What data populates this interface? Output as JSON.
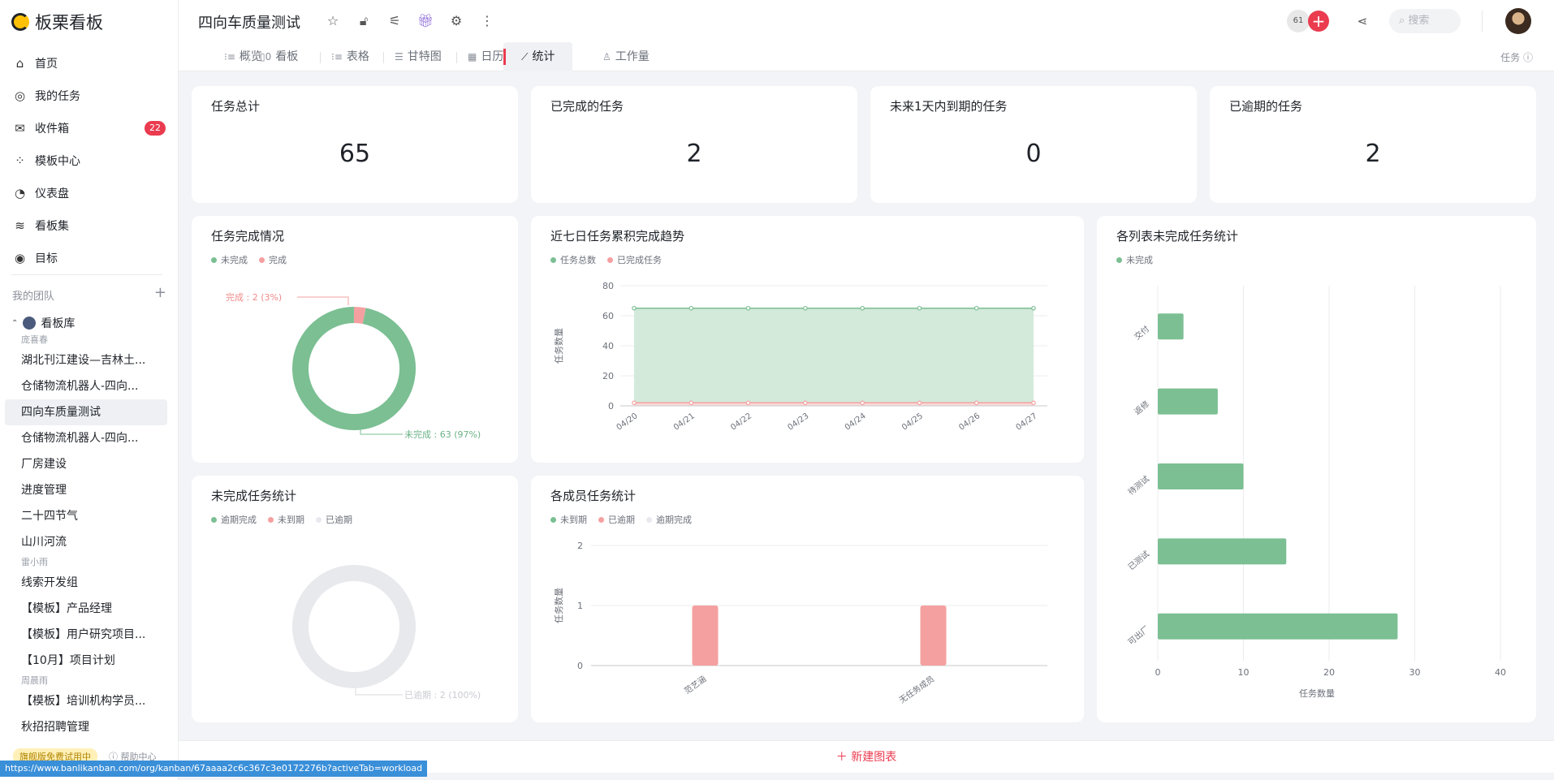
{
  "app": {
    "name": "板栗看板"
  },
  "sidebar": {
    "nav": [
      {
        "label": "首页",
        "icon": "home-icon",
        "glyph": "⌂"
      },
      {
        "label": "我的任务",
        "icon": "check-circle-icon",
        "glyph": "◎"
      },
      {
        "label": "收件箱",
        "icon": "mail-icon",
        "glyph": "✉",
        "badge": "22"
      },
      {
        "label": "模板中心",
        "icon": "template-icon",
        "glyph": "⁘"
      },
      {
        "label": "仪表盘",
        "icon": "pie-icon",
        "glyph": "◔"
      },
      {
        "label": "看板集",
        "icon": "layers-icon",
        "glyph": "≋"
      },
      {
        "label": "目标",
        "icon": "target-icon",
        "glyph": "◉"
      }
    ],
    "team_header": "我的团队",
    "workspace": "看板库",
    "tree": [
      {
        "group": "庞喜春"
      },
      {
        "label": "湖北刊江建设—吉林土..."
      },
      {
        "label": "仓储物流机器人-四向..."
      },
      {
        "label": "四向车质量测试",
        "active": true
      },
      {
        "label": "仓储物流机器人-四向..."
      },
      {
        "label": "厂房建设"
      },
      {
        "label": "进度管理"
      },
      {
        "label": "二十四节气"
      },
      {
        "label": "山川河流"
      },
      {
        "group": "雷小雨"
      },
      {
        "label": "线索开发组"
      },
      {
        "label": "【模板】产品经理"
      },
      {
        "label": "【模板】用户研究项目..."
      },
      {
        "label": "【10月】项目计划"
      },
      {
        "group": "周晨雨"
      },
      {
        "label": "【模板】培训机构学员..."
      },
      {
        "label": "秋招招聘管理"
      }
    ],
    "trial": "旗舰版免费试用中",
    "help": "帮助中心"
  },
  "header": {
    "title": "四向车质量测试",
    "member_count": "61",
    "search_placeholder": "搜索"
  },
  "tabs": [
    {
      "label": "概览",
      "icon": "list-icon",
      "glyph": "⁝≡"
    },
    {
      "label": "看板",
      "icon": "board-icon",
      "glyph": "▯0"
    },
    {
      "label": "表格",
      "icon": "table-icon",
      "glyph": "⁝≡"
    },
    {
      "label": "甘特图",
      "icon": "gantt-icon",
      "glyph": "☰"
    },
    {
      "label": "日历",
      "icon": "calendar-icon",
      "glyph": "▦"
    },
    {
      "label": "统计",
      "icon": "stats-icon",
      "glyph": "⟋",
      "active": true
    },
    {
      "label": "工作量",
      "icon": "workload-icon",
      "glyph": "♙"
    }
  ],
  "tab_right": "任务 ⓘ",
  "stats": [
    {
      "title": "任务总计",
      "value": "65"
    },
    {
      "title": "已完成的任务",
      "value": "2"
    },
    {
      "title": "未来1天内到期的任务",
      "value": "0"
    },
    {
      "title": "已逾期的任务",
      "value": "2"
    }
  ],
  "colors": {
    "green": "#7bbf93",
    "red": "#f5a0a0",
    "grey": "#e8e9ed",
    "accent": "#ea3b4f"
  },
  "chart_data": [
    {
      "type": "pie",
      "title": "任务完成情况",
      "legend": [
        "未完成",
        "完成"
      ],
      "slices": [
        {
          "name": "未完成",
          "value": 63,
          "label": "未完成 : 63 (97%)"
        },
        {
          "name": "完成",
          "value": 2,
          "label": "完成 : 2 (3%)"
        }
      ]
    },
    {
      "type": "area",
      "title": "近七日任务累积完成趋势",
      "ylabel": "任务数量",
      "x": [
        "04/20",
        "04/21",
        "04/22",
        "04/23",
        "04/24",
        "04/25",
        "04/26",
        "04/27"
      ],
      "ylim": [
        0,
        80
      ],
      "yticks": [
        0,
        20,
        40,
        60,
        80
      ],
      "series": [
        {
          "name": "任务总数",
          "values": [
            65,
            65,
            65,
            65,
            65,
            65,
            65,
            65
          ]
        },
        {
          "name": "已完成任务",
          "values": [
            2,
            2,
            2,
            2,
            2,
            2,
            2,
            2
          ]
        }
      ]
    },
    {
      "type": "bar",
      "orientation": "horizontal",
      "title": "各列表未完成任务统计",
      "legend": [
        "未完成"
      ],
      "xlabel": "任务数量",
      "categories": [
        "交付",
        "返修",
        "待测试",
        "已测试",
        "可出厂"
      ],
      "values": [
        3,
        7,
        10,
        15,
        28
      ],
      "xlim": [
        0,
        40
      ],
      "xticks": [
        0,
        10,
        20,
        30,
        40
      ]
    },
    {
      "type": "pie",
      "title": "未完成任务统计",
      "legend": [
        "逾期完成",
        "未到期",
        "已逾期"
      ],
      "slices": [
        {
          "name": "已逾期",
          "value": 2,
          "label": "已逾期 : 2 (100%)"
        }
      ]
    },
    {
      "type": "bar",
      "title": "各成员任务统计",
      "legend": [
        "未到期",
        "已逾期",
        "逾期完成"
      ],
      "ylabel": "任务数量",
      "categories": [
        "范艺涵",
        "无任务成员"
      ],
      "ylim": [
        0,
        2
      ],
      "yticks": [
        0,
        1,
        2
      ],
      "series": [
        {
          "name": "未到期",
          "values": [
            0,
            0
          ]
        },
        {
          "name": "已逾期",
          "values": [
            1,
            1
          ]
        },
        {
          "name": "逾期完成",
          "values": [
            0,
            0
          ]
        }
      ]
    }
  ],
  "new_chart": "＋ 新建图表",
  "status_url": "https://www.banlikanban.com/org/kanban/67aaaa2c6c367c3e0172276b?activeTab=workload"
}
